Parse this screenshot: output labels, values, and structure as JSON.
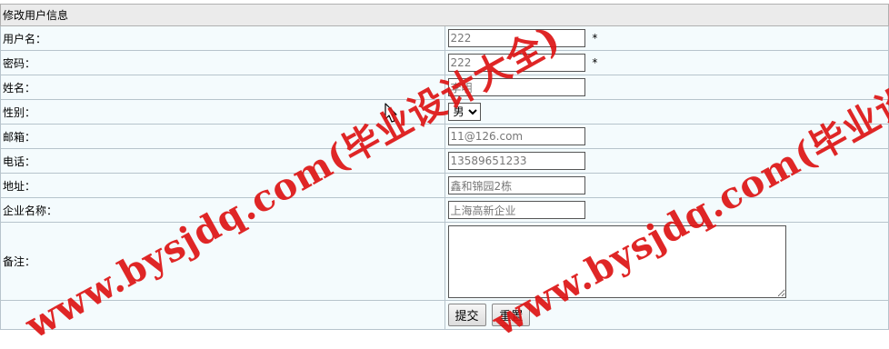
{
  "form": {
    "title": "修改用户信息",
    "fields": {
      "username": {
        "label": "用户名：",
        "value": "222",
        "required_mark": "*"
      },
      "password": {
        "label": "密码：",
        "value": "222",
        "required_mark": "*"
      },
      "name": {
        "label": "姓名：",
        "value": "李明"
      },
      "gender": {
        "label": "性别：",
        "selected": "男"
      },
      "email": {
        "label": "邮箱：",
        "value": "11@126.com"
      },
      "phone": {
        "label": "电话：",
        "value": "13589651233"
      },
      "address": {
        "label": "地址：",
        "value": "鑫和锦园2栋"
      },
      "company": {
        "label": "企业名称：",
        "value": "上海高新企业"
      },
      "remark": {
        "label": "备注：",
        "value": ""
      }
    },
    "buttons": {
      "submit": "提交",
      "reset": "重置"
    }
  },
  "watermarks": [
    "www.bysjdq.com(毕业设计大全)",
    "www.bysjdq.com(毕业设计大"
  ],
  "colors": {
    "row_bg": "#f4fbfd",
    "header_bg": "#ebebeb",
    "watermark": "#dc1414"
  }
}
